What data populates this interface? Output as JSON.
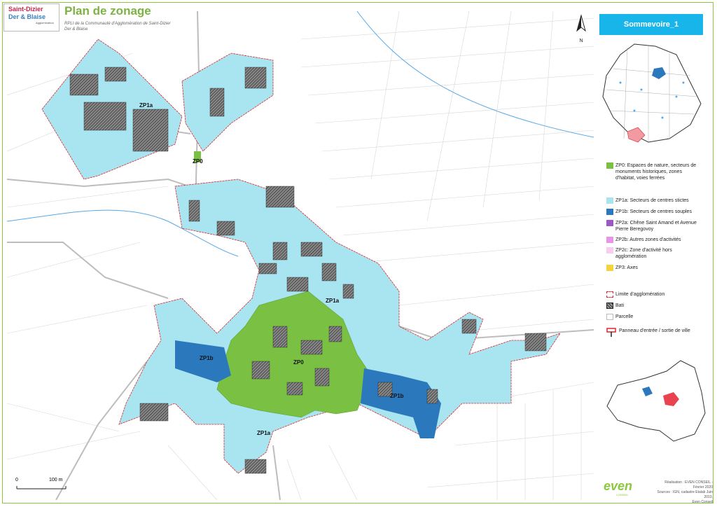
{
  "header": {
    "logo_line1": "Saint-Dizier",
    "logo_line2": "Der & Blaise",
    "logo_line3": "Agglomération",
    "title": "Plan de zonage",
    "subtitle": "RPLI de la Communauté d'Agglomération de Saint-Dizier Der & Blaise"
  },
  "commune": "Sommevoire_1",
  "north_label": "N",
  "map_labels": {
    "zp1a_north": "ZP1a",
    "zp0_north": "ZP0",
    "zp1a_center": "ZP1a",
    "zp1b_west": "ZP1b",
    "zp0_center": "ZP0",
    "zp1b_east": "ZP1b",
    "zp1a_south": "ZP1a"
  },
  "legend": {
    "zp0": "ZP0: Espaces de nature, secteurs de monuments historiques, zones d'habitat, voies ferrées",
    "zp1a": "ZP1a: Secteurs de centres stictes",
    "zp1b": "ZP1b: Secteurs de centres souples",
    "zp2a": "ZP2a: Chêne Saint Amand et Avenue Pierre Beregovoy",
    "zp2b": "ZP2b: Autres zones d'activités",
    "zp2c": "ZP2c: Zone d'activité hors agglomération",
    "zp3": "ZP3: Axes",
    "limite": "Limite d'agglomération",
    "bati": "Bati",
    "parcelle": "Parcelle",
    "panneau": "Panneau d'entrée / sortie de ville"
  },
  "colors": {
    "zp0": "#7ac143",
    "zp1a": "#a9e4f1",
    "zp1b": "#2c78bd",
    "zp2a": "#9b59c5",
    "zp2b": "#e695e8",
    "zp2c": "#f7cdf0",
    "zp3": "#f5d33a",
    "limite": "#d9262c",
    "frame": "#8dc63f",
    "commune_box": "#17b5ea"
  },
  "scale": {
    "start": "0",
    "end": "100 m"
  },
  "footer": {
    "line1": "Réalisation : EVEN CONSEIL - Février 2020",
    "line2": "Sources : IGN, cadastre Etalab Juin 2019,",
    "line3": "Even Conseil"
  },
  "brand": {
    "name": "even",
    "sub": "CONSEIL"
  }
}
